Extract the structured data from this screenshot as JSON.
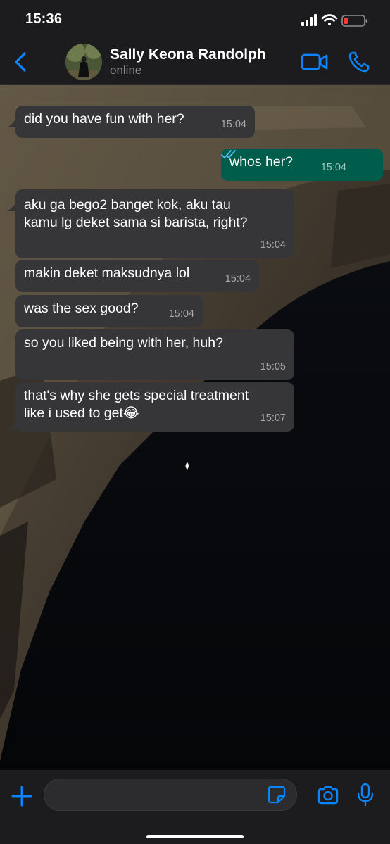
{
  "status_bar": {
    "time": "15:36"
  },
  "header": {
    "contact_name": "Sally Keona Randolph",
    "contact_status": "online",
    "icons": [
      "back-chevron-icon",
      "avatar",
      "video-call-icon",
      "phone-call-icon"
    ]
  },
  "messages": [
    {
      "direction": "in",
      "text": "did you have fun with her?",
      "time": "15:04"
    },
    {
      "direction": "out",
      "text": "whos her?",
      "time": "15:04",
      "read": true
    },
    {
      "direction": "in",
      "text": "aku ga bego2 banget kok, aku tau\nkamu lg deket sama si barista, right?",
      "time": "15:04"
    },
    {
      "direction": "in",
      "text": "makin deket maksudnya lol",
      "time": "15:04"
    },
    {
      "direction": "in",
      "text": "was the sex good?",
      "time": "15:04"
    },
    {
      "direction": "in",
      "text": "so you liked being with her, huh?",
      "time": "15:05"
    },
    {
      "direction": "in",
      "text": "that's why she gets special treatment\nlike i used to get😂",
      "time": "15:07"
    }
  ],
  "input_bar": {
    "icons": [
      "plus-icon",
      "sticker-icon",
      "camera-icon",
      "microphone-icon"
    ]
  },
  "colors": {
    "accent": "#0a84ff",
    "incoming_bubble": "#363638",
    "outgoing_bubble": "#005c4b",
    "bar_background": "#1c1c1e"
  }
}
